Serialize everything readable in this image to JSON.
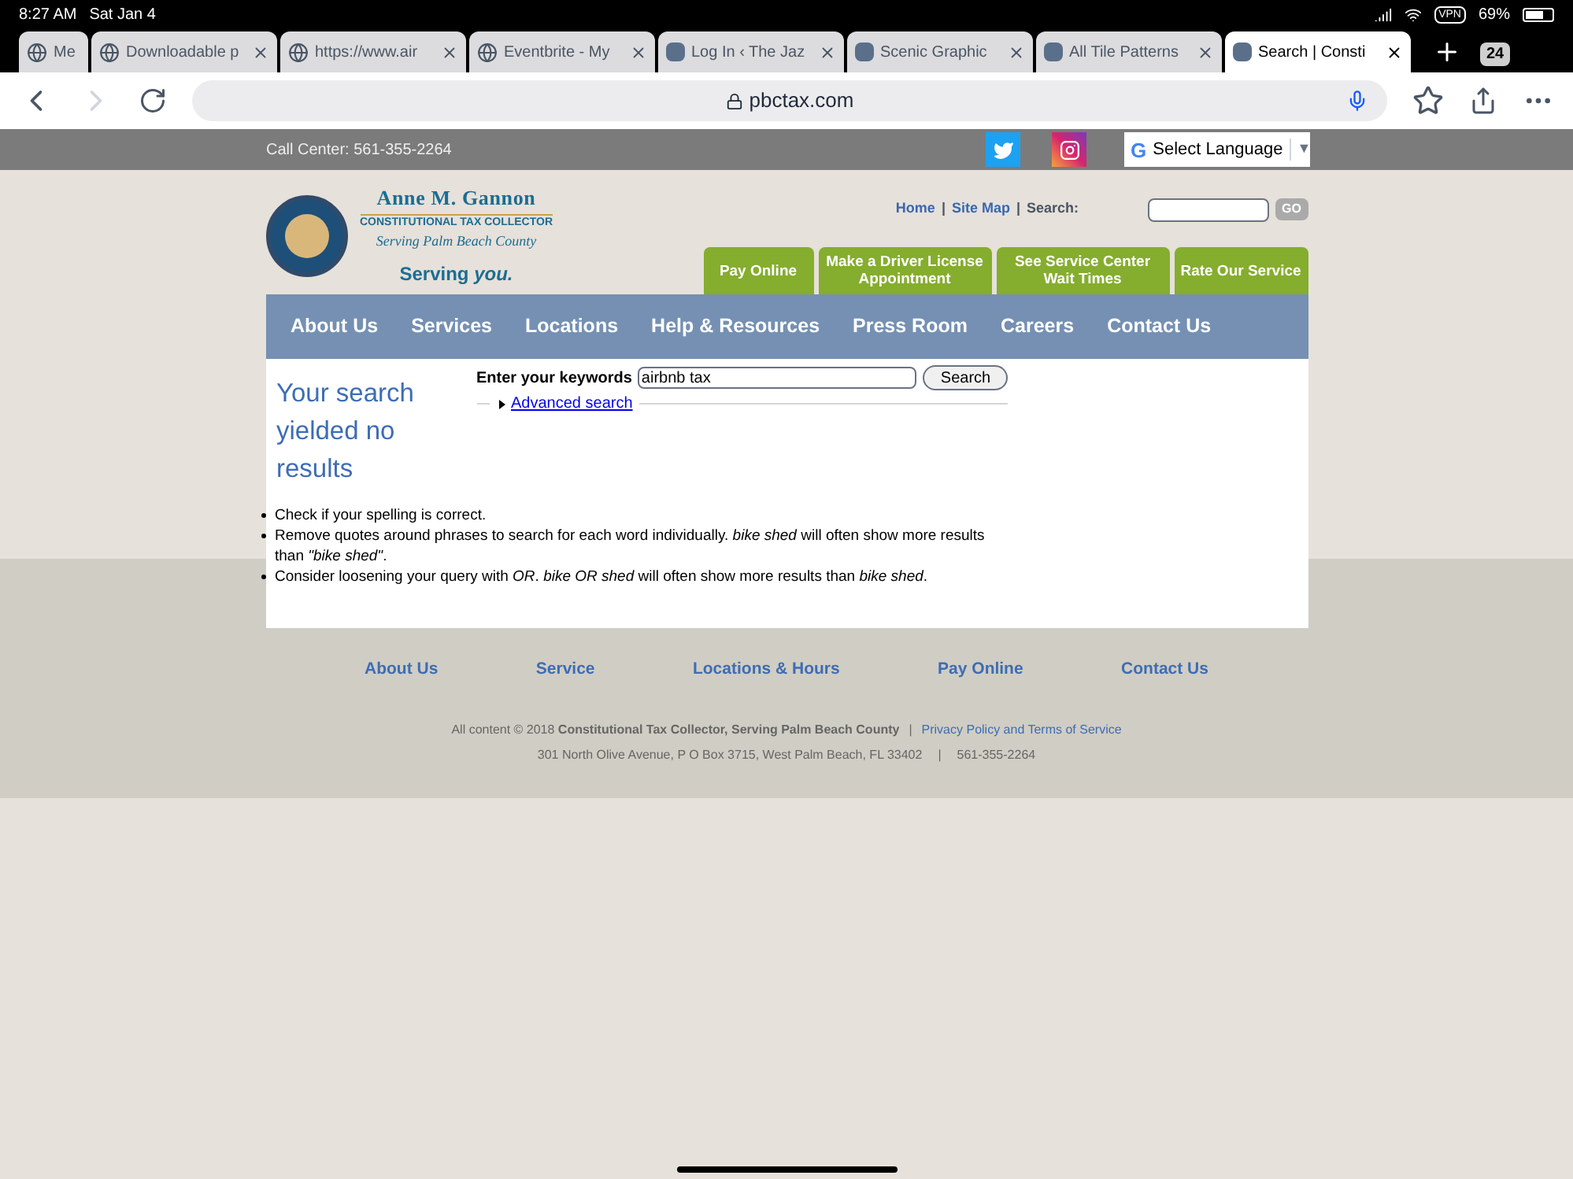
{
  "status_bar": {
    "time": "8:27 AM",
    "date": "Sat Jan 4",
    "vpn": "VPN",
    "battery": "69%"
  },
  "browser_tabs": [
    {
      "title": "Me",
      "selected": false
    },
    {
      "title": "Downloadable p",
      "selected": false
    },
    {
      "title": "https://www.air",
      "selected": false
    },
    {
      "title": "Eventbrite - My",
      "selected": false
    },
    {
      "title": "Log In ‹ The Jaz",
      "selected": false
    },
    {
      "title": "Scenic Graphic",
      "selected": false
    },
    {
      "title": "All Tile Patterns",
      "selected": false
    },
    {
      "title": "Search | Consti",
      "selected": true
    }
  ],
  "tab_count": "24",
  "address": "pbctax.com",
  "topbar": {
    "call_center": "Call Center: 561-355-2264",
    "google_g": "G",
    "language": "Select Language",
    "language_caret": "▼"
  },
  "logo": {
    "name": "Anne M. Gannon",
    "subtitle": "CONSTITUTIONAL TAX COLLECTOR",
    "county": "Serving Palm Beach County",
    "slogan": "Serving *you.*"
  },
  "utility_links": [
    {
      "label": "Home",
      "sep": "|"
    },
    {
      "label": "Site Map",
      "sep": "|"
    }
  ],
  "search_label": "Search:",
  "go": "GO",
  "action_tabs": [
    "Pay Online",
    "Make a Driver License Appointment",
    "See Service Center Wait Times",
    "Rate Our Service"
  ],
  "nav": [
    "About Us",
    "Services",
    "Locations",
    "Help & Resources",
    "Press Room",
    "Careers",
    "Contact Us"
  ],
  "results": {
    "heading": "Your search yielded no results",
    "keywords_label": "Enter your keywords",
    "keywords": "airbnb tax",
    "search_button": "Search",
    "advanced": "Advanced search",
    "tips": [
      "Check if your spelling is correct.",
      "Remove quotes around phrases to search for each word individually. *bike shed* will often show more results than *\"bike shed\"*.",
      "Consider loosening your query with *OR*. *bike OR shed* will often show more results than *bike shed*."
    ]
  },
  "footer": {
    "links": [
      "About Us",
      "Service",
      "Locations & Hours",
      "Pay Online",
      "Contact Us"
    ],
    "copyright": "All content © 2018 **Constitutional Tax Collector, Serving Palm Beach County**",
    "sep": "|",
    "privacy": "Privacy Policy and Terms of Service",
    "address": "301 North Olive Avenue, P O Box 3715, West Palm Beach, FL 33402",
    "sep2": "|",
    "phone": "561-355-2264"
  }
}
